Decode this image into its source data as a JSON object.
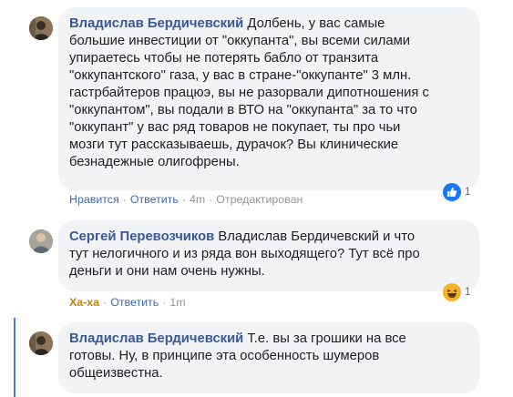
{
  "comments": [
    {
      "author": "Владислав Бердичевский",
      "lines": [
        " Долбень, у вас самые",
        "большие инвестиции от \"оккупанта\", вы всеми силами",
        "упираетесь чтобы не потерять бабло от транзита",
        "\"оккупантского\" газа, у вас в стране-\"оккупанте\" 3 млн.",
        "гастрбайтеров працюэ, вы не разорвали дипотношения с",
        "\"оккупантом\", вы подали в ВТО на \"оккупанта\" за то что",
        "\"оккупант\" у вас ряд товаров не покупает, ты про чьи",
        "мозги тут рассказываешь, дурачок? Вы клинические",
        "безнадежные олигофрены."
      ],
      "actions": {
        "like": "Нравится",
        "reply": "Ответить",
        "time": "4m",
        "edited": "Отредактирован"
      },
      "reaction": {
        "icon": "like-icon",
        "count": "1",
        "color": "#1877f2"
      }
    },
    {
      "author": "Сергей Перевозчиков",
      "lines": [
        " Владислав Бердичевский и что",
        "тут нелогичного и из ряда вон выходящего? Тут всё про",
        "деньги и они нам очень нужны."
      ],
      "actions": {
        "like": "Ха-ха",
        "reply": "Ответить",
        "time": "1m"
      },
      "reaction": {
        "icon": "haha-icon",
        "count": "1",
        "color": "#f7b125"
      }
    },
    {
      "author": "Владислав Бердичевский",
      "lines": [
        " Т.е. вы за грошики на все",
        "готовы. Ну, в принципе эта особенность шумеров",
        "общеизвестна."
      ]
    }
  ],
  "colors": {
    "author": "#385898",
    "link": "#4267b2",
    "haha_label": "#b8860b",
    "bubble": "#f2f3f5",
    "thread_line": "#4a76d6"
  },
  "separator": "·"
}
